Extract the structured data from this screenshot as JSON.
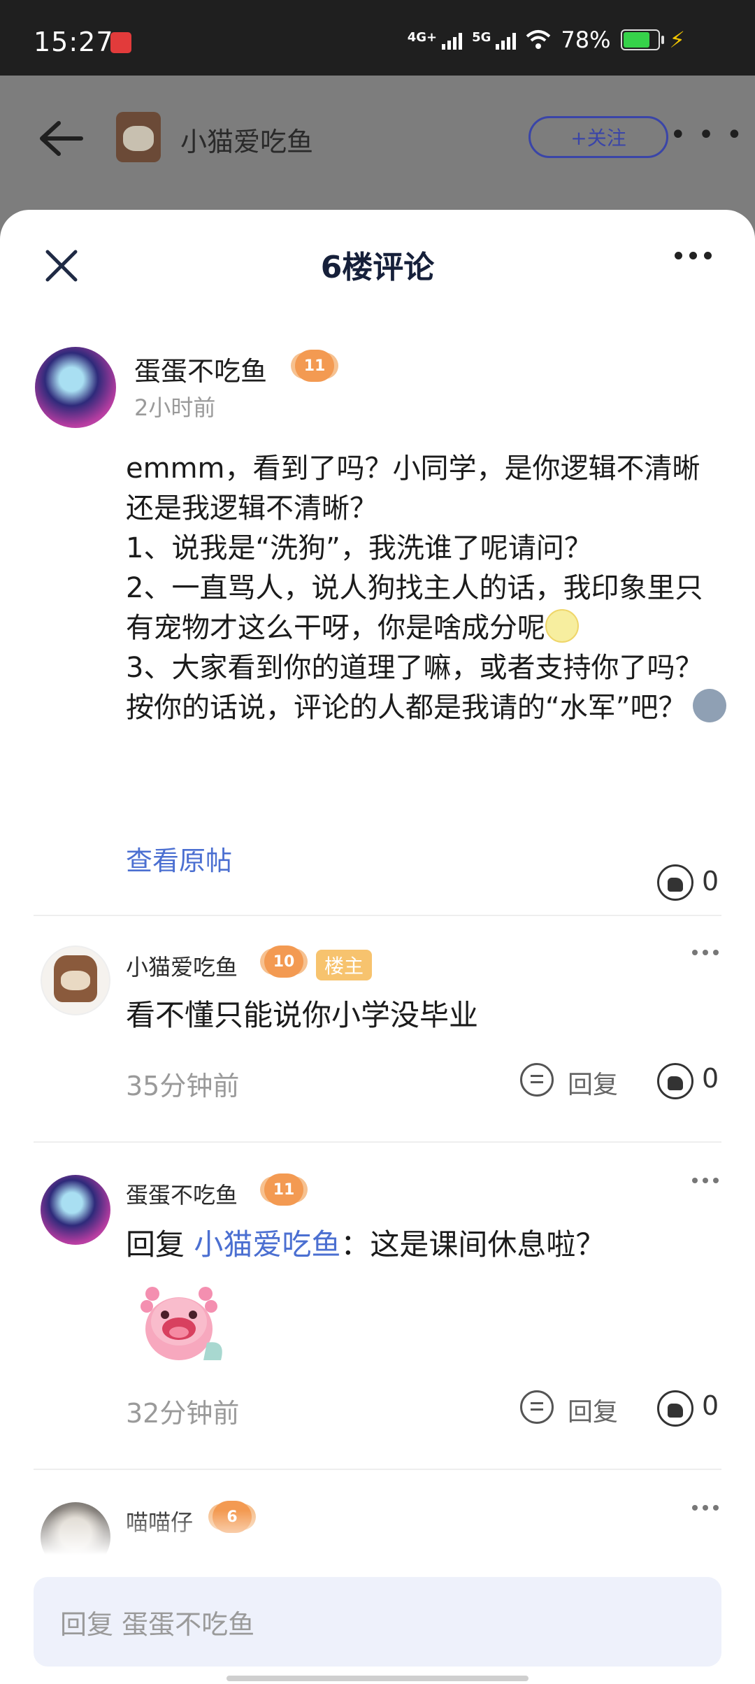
{
  "status_bar": {
    "time": "15:27",
    "network1": "4G+",
    "network2": "5G",
    "battery_percent": "78%",
    "battery_level": 0.78
  },
  "header": {
    "username": "小猫爱吃鱼",
    "follow_label": "+关注",
    "more_icon": "more-horizontal-icon",
    "back_icon": "arrow-left-icon"
  },
  "sheet": {
    "title": "6楼评论",
    "close_icon": "close-icon",
    "more_icon": "more-horizontal-icon"
  },
  "main_comment": {
    "author": "蛋蛋不吃鱼",
    "level": "11",
    "time": "2小时前",
    "body_part1": "emmm，看到了吗？小同学，是你逻辑不清晰还是我逻辑不清晰？\n1、说我是“洗狗”，我洗谁了呢请问？\n2、一直骂人，说人狗找主人的话，我印象里只有宠物才这么干呀，你是啥成分呢",
    "body_part2": "\n3、大家看到你的道理了嘛，或者支持你了吗？按你的话说，评论的人都是我请的“水军”吧？",
    "view_original": "查看原帖",
    "likes": "0"
  },
  "replies": [
    {
      "author": "小猫爱吃鱼",
      "level": "10",
      "tag": "楼主",
      "text": "看不懂只能说你小学没毕业",
      "time": "35分钟前",
      "reply_label": "回复",
      "likes": "0"
    },
    {
      "author": "蛋蛋不吃鱼",
      "level": "11",
      "reply_prefix": "回复 ",
      "mention": "小猫爱吃鱼",
      "text": "：这是课间休息啦？",
      "time": "32分钟前",
      "reply_label": "回复",
      "likes": "0"
    },
    {
      "author": "喵喵仔",
      "level": "6"
    }
  ],
  "reply_input": {
    "placeholder": "回复 蛋蛋不吃鱼"
  },
  "colors": {
    "link": "#4b6fd1",
    "tag_host": "#f7c36e",
    "level_badge": "#f39a52"
  }
}
